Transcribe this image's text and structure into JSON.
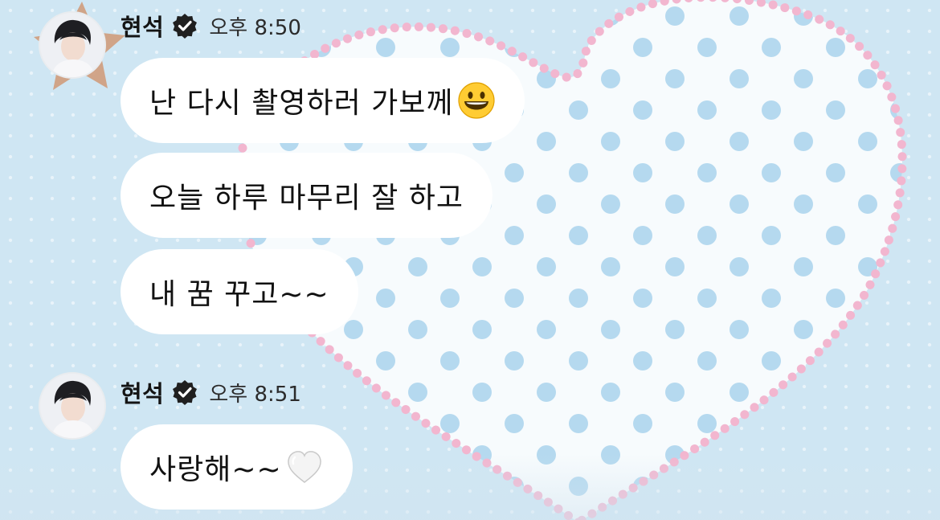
{
  "theme": {
    "background": "#cfe6f3",
    "bubble_color": "#ffffff",
    "heart_dot_color": "#f2b6cf",
    "polka_dot_color": "#a9d4ec",
    "star_color": "#cf9c7c"
  },
  "messages": [
    {
      "sender": "현석",
      "verified": true,
      "time": "오후 8:50",
      "avatar": "profile-photo",
      "lines": [
        {
          "text": "난 다시 촬영하러 가보께",
          "emoji": "grinning-face-emoji"
        },
        {
          "text": "오늘 하루 마무리 잘 하고"
        },
        {
          "text": "내 꿈 꾸고~~"
        }
      ]
    },
    {
      "sender": "현석",
      "verified": true,
      "time": "오후 8:51",
      "avatar": "profile-photo",
      "lines": [
        {
          "text": "사랑해~~",
          "emoji": "white-heart-emoji"
        }
      ]
    }
  ]
}
